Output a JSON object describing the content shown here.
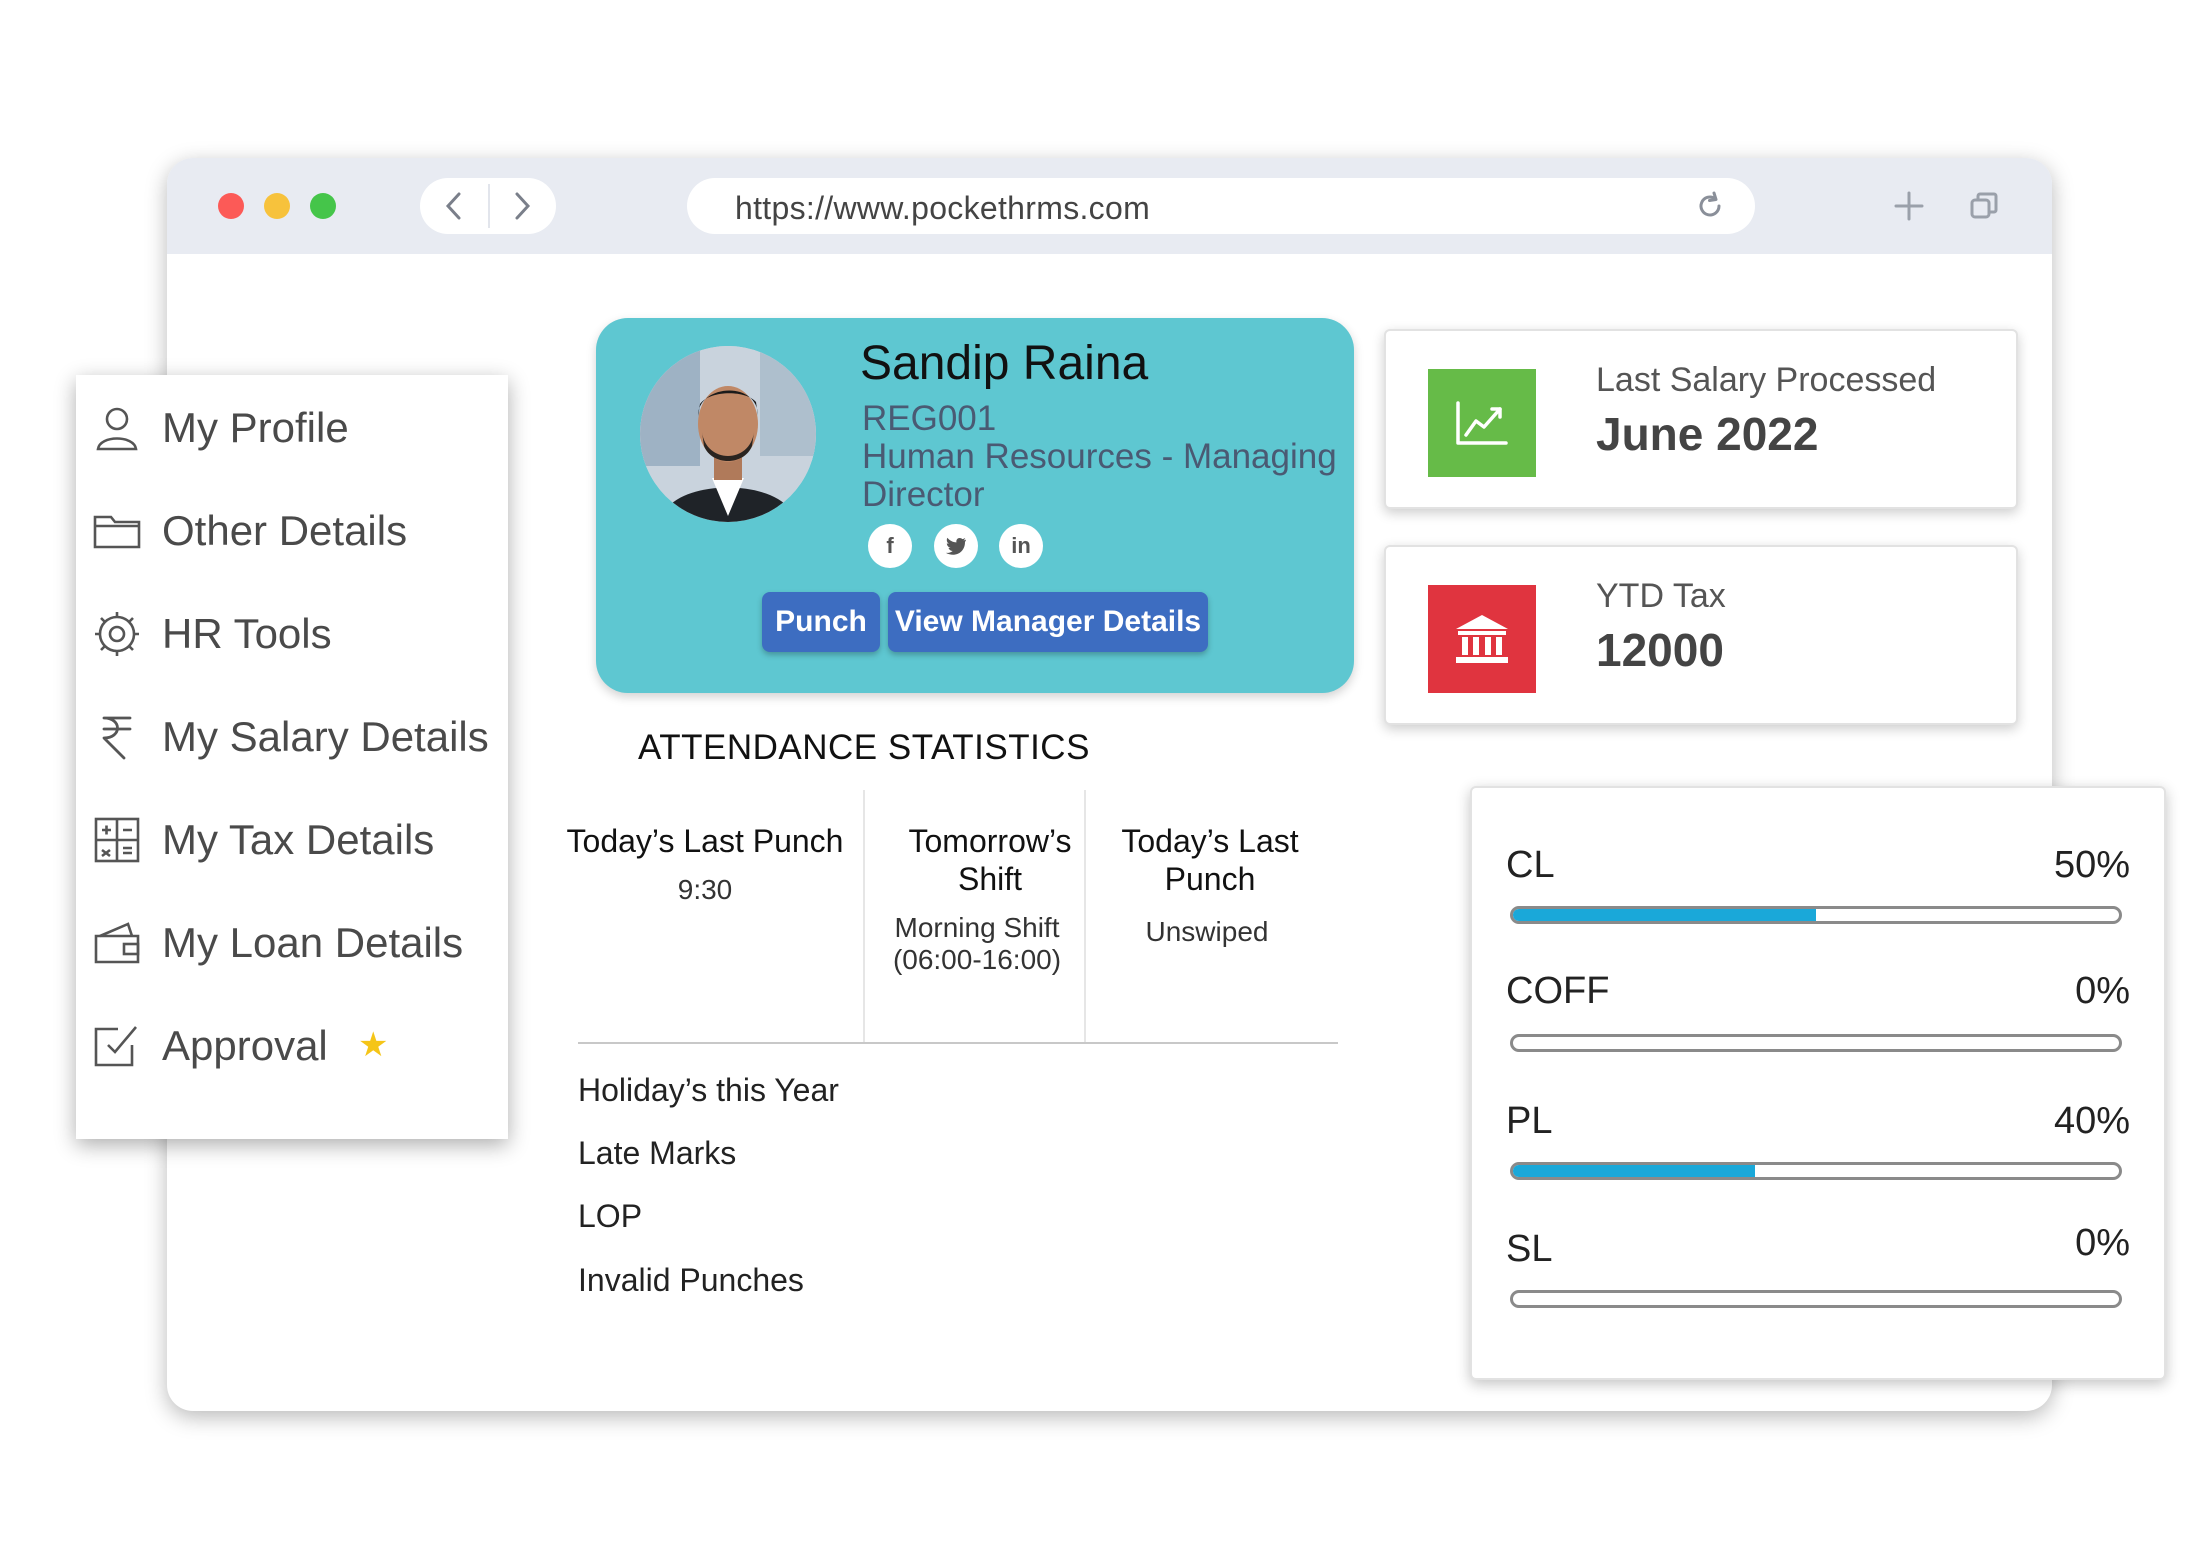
{
  "browser": {
    "url": "https://www.pockethrms.com",
    "traffic_colors": [
      "#fc5a57",
      "#f7c23c",
      "#45c54a"
    ],
    "icons": {
      "back": "chevron-left-icon",
      "forward": "chevron-right-icon",
      "reload": "reload-icon",
      "new_tab": "plus-icon",
      "tabs": "tabs-icon"
    }
  },
  "sidebar": {
    "items": [
      {
        "label": "My Profile",
        "icon": "user-icon"
      },
      {
        "label": "Other Details",
        "icon": "folder-icon"
      },
      {
        "label": "HR Tools",
        "icon": "hr-tools-icon"
      },
      {
        "label": "My Salary Details",
        "icon": "rupee-icon"
      },
      {
        "label": "My Tax Details",
        "icon": "calculator-icon"
      },
      {
        "label": "My Loan Details",
        "icon": "wallet-icon"
      },
      {
        "label": "Approval",
        "icon": "approval-icon",
        "badge_icon": "star-icon"
      }
    ]
  },
  "profile": {
    "name": "Sandip Raina",
    "code": "REG001",
    "department_line1": "Human Resources - Managing",
    "department_line2": "Director",
    "social": [
      {
        "name": "facebook",
        "glyph": "f"
      },
      {
        "name": "twitter",
        "glyph": "♥"
      },
      {
        "name": "linkedin",
        "glyph": "in"
      }
    ],
    "buttons": {
      "punch": "Punch",
      "manager": "View Manager Details"
    },
    "card_color": "#5ec7d1",
    "button_color": "#3d6dc1"
  },
  "cards": {
    "salary": {
      "label": "Last Salary Processed",
      "value": "June 2022",
      "icon": "chart-trend-icon",
      "icon_color": "#66bb48"
    },
    "tax": {
      "label": "YTD Tax",
      "value": "12000",
      "icon": "bank-icon",
      "icon_color": "#e0343f"
    }
  },
  "attendance": {
    "title": "ATTENDANCE STATISTICS",
    "columns": [
      {
        "head_line1": "Today’s Last Punch",
        "head_line2": "",
        "value_line1": "9:30",
        "value_line2": ""
      },
      {
        "head_line1": "Tomorrow’s",
        "head_line2": "Shift",
        "value_line1": "Morning Shift",
        "value_line2": "(06:00-16:00)"
      },
      {
        "head_line1": "Today’s Last",
        "head_line2": "Punch",
        "value_line1": "Unswiped",
        "value_line2": ""
      }
    ],
    "list": [
      "Holiday’s this Year",
      "Late Marks",
      "LOP",
      "Invalid Punches"
    ]
  },
  "leaves": {
    "fill_color": "#1aa8d9",
    "items": [
      {
        "label": "CL",
        "percent_text": "50%",
        "fraction": 0.5
      },
      {
        "label": "COFF",
        "percent_text": "0%",
        "fraction": 0
      },
      {
        "label": "PL",
        "percent_text": "40%",
        "fraction": 0.4
      },
      {
        "label": "SL",
        "percent_text": "0%",
        "fraction": 0
      }
    ]
  }
}
